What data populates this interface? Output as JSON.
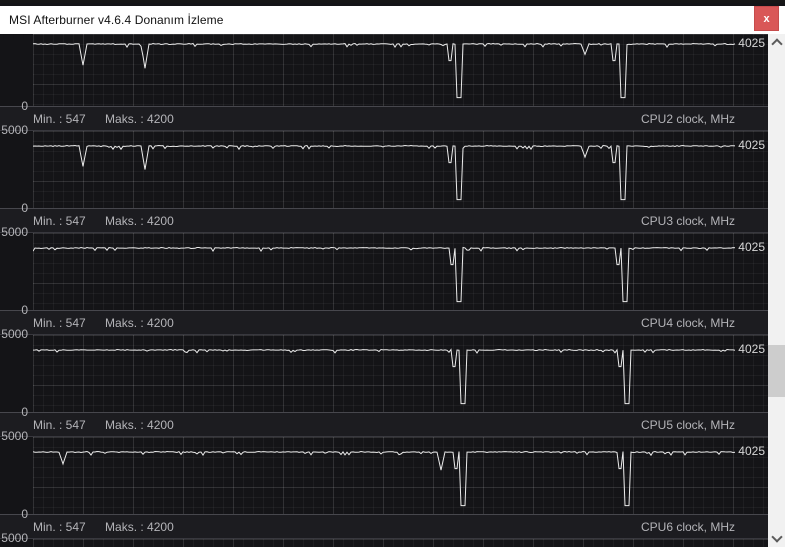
{
  "window": {
    "title": "MSI Afterburner v4.6.4 Donanım İzleme",
    "close_label": "x"
  },
  "colors": {
    "titlebar_bg": "#ffffff",
    "close_button_red": "#d95757",
    "plot_bg": "#141417",
    "footer_bg": "#1c1c20",
    "grid_line": "#232329",
    "trace_line": "#ececec",
    "label_text": "#b4b4b8",
    "current_value_text": "#d6d6d6",
    "scrollbar_track": "#f1f1f1",
    "scrollbar_thumb": "#cdcdcd"
  },
  "chart_data": {
    "type": "line",
    "unit": "MHz",
    "ylim": [
      0,
      5000
    ],
    "y_axis_top_label": "5000",
    "y_axis_bottom_label": "0",
    "grid": true,
    "legend_position": "bottom-right",
    "series": [
      {
        "label": "CPU2 clock, MHz",
        "min": 547,
        "max": 4200,
        "current": 4025,
        "baseline": 4025,
        "min_text": "Min. : 547",
        "max_text": "Maks. : 4200",
        "partial_top": true,
        "dips": [
          {
            "x": 0.07,
            "v": 2650
          },
          {
            "x": 0.16,
            "v": 2450
          },
          {
            "x": 0.604,
            "v": 547,
            "deep": true
          },
          {
            "x": 0.786,
            "v": 3350
          },
          {
            "x": 0.839,
            "v": 547,
            "deep": true
          }
        ]
      },
      {
        "label": "CPU3 clock, MHz",
        "min": 547,
        "max": 4200,
        "current": 4025,
        "baseline": 4025,
        "min_text": "Min. : 547",
        "max_text": "Maks. : 4200",
        "dips": [
          {
            "x": 0.07,
            "v": 2700
          },
          {
            "x": 0.16,
            "v": 2500
          },
          {
            "x": 0.604,
            "v": 547,
            "deep": true
          },
          {
            "x": 0.786,
            "v": 3300
          },
          {
            "x": 0.839,
            "v": 547,
            "deep": true
          }
        ]
      },
      {
        "label": "CPU4 clock, MHz",
        "min": 547,
        "max": 4200,
        "current": 4025,
        "baseline": 4025,
        "min_text": "Min. : 547",
        "max_text": "Maks. : 4200",
        "dips": [
          {
            "x": 0.606,
            "v": 547,
            "deep": true
          },
          {
            "x": 0.842,
            "v": 547,
            "deep": true
          }
        ]
      },
      {
        "label": "CPU5 clock, MHz",
        "min": 547,
        "max": 4200,
        "current": 4025,
        "baseline": 4025,
        "min_text": "Min. : 547",
        "max_text": "Maks. : 4200",
        "dips": [
          {
            "x": 0.61,
            "v": 547,
            "deep": true
          },
          {
            "x": 0.845,
            "v": 547,
            "deep": true
          }
        ]
      },
      {
        "label": "CPU6 clock, MHz",
        "min": 547,
        "max": 4200,
        "current": 4025,
        "baseline": 4025,
        "min_text": "Min. : 547",
        "max_text": "Maks. : 4200",
        "dips": [
          {
            "x": 0.044,
            "v": 3250
          },
          {
            "x": 0.58,
            "v": 2850
          },
          {
            "x": 0.612,
            "v": 547,
            "deep": true
          },
          {
            "x": 0.846,
            "v": 547,
            "deep": true
          }
        ]
      },
      {
        "partial_bottom": true
      }
    ]
  }
}
